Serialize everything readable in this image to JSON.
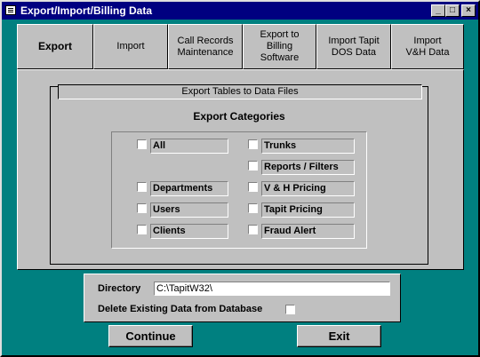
{
  "window": {
    "title": "Export/Import/Billing Data"
  },
  "titlebar": {
    "icon": "form-icon",
    "minimize": "minimize-icon",
    "maximize": "maximize-icon",
    "close": "close-icon"
  },
  "tabs": [
    {
      "label": "Export",
      "active": true
    },
    {
      "label": "Import",
      "active": false
    },
    {
      "label": "Call Records\nMaintenance",
      "active": false
    },
    {
      "label": "Export to\nBilling\nSoftware",
      "active": false
    },
    {
      "label": "Import Tapit\nDOS Data",
      "active": false
    },
    {
      "label": "Import\nV&H Data",
      "active": false
    }
  ],
  "export": {
    "group_title": "Export Tables to Data Files",
    "categories_heading": "Export Categories",
    "categories": {
      "all": {
        "label": "All",
        "checked": false
      },
      "trunks": {
        "label": "Trunks",
        "checked": false
      },
      "reports_filters": {
        "label": "Reports / Filters",
        "checked": false
      },
      "departments": {
        "label": "Departments",
        "checked": false
      },
      "vh_pricing": {
        "label": "V & H Pricing",
        "checked": false
      },
      "users": {
        "label": "Users",
        "checked": false
      },
      "tapit_pricing": {
        "label": "Tapit Pricing",
        "checked": false
      },
      "clients": {
        "label": "Clients",
        "checked": false
      },
      "fraud_alert": {
        "label": "Fraud Alert",
        "checked": false
      }
    }
  },
  "directory": {
    "label": "Directory",
    "value": "C:\\TapitW32\\",
    "delete_label": "Delete Existing Data from Database",
    "delete_checked": false
  },
  "buttons": {
    "continue": "Continue",
    "exit": "Exit"
  },
  "colors": {
    "desktop": "#008080",
    "titlebar": "#000080",
    "face": "#c0c0c0"
  }
}
